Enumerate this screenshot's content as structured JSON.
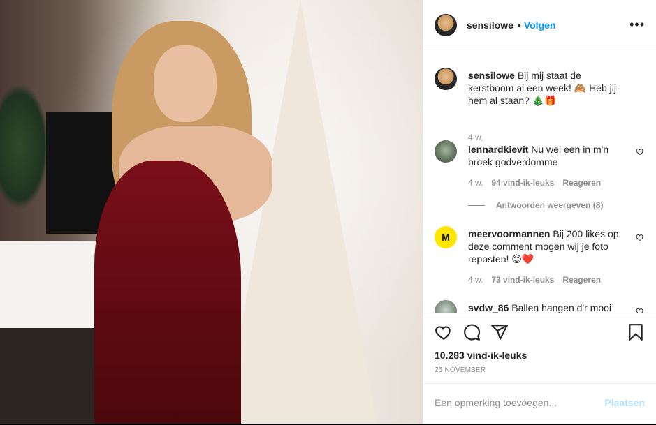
{
  "header": {
    "username": "sensilowe",
    "separator": "•",
    "follow_label": "Volgen",
    "more_label": "•••"
  },
  "caption": {
    "username": "sensilowe",
    "text": "Bij mij staat de kerstboom al een week! 🙈 Heb jij hem al staan? 🎄🎁",
    "time": "4 w."
  },
  "comments": [
    {
      "username": "lennardkievit",
      "text": "Nu wel een in m'n broek godverdomme",
      "time": "4 w.",
      "likes": "94 vind-ik-leuks",
      "reply": "Reageren",
      "view_replies": "Antwoorden weergeven (8)"
    },
    {
      "username": "meervoormannen",
      "avatar_letter": "M",
      "text": "Bij 200 likes op deze comment mogen wij je foto reposten! 😊❤️",
      "time": "4 w.",
      "likes": "73 vind-ik-leuks",
      "reply": "Reageren"
    },
    {
      "username": "svdw_86",
      "text": "Ballen hangen d'r mooi"
    }
  ],
  "actions": {
    "like_icon": "heart-icon",
    "comment_icon": "comment-icon",
    "share_icon": "share-icon",
    "save_icon": "bookmark-icon"
  },
  "likes_count": "10.283 vind-ik-leuks",
  "post_date": "25 NOVEMBER",
  "add_comment": {
    "placeholder": "Een opmerking toevoegen...",
    "post_label": "Plaatsen"
  },
  "colors": {
    "link_blue": "#0095f6",
    "post_disabled": "#b2dffc",
    "muted_text": "#8e8e8e",
    "border": "#efefef"
  }
}
